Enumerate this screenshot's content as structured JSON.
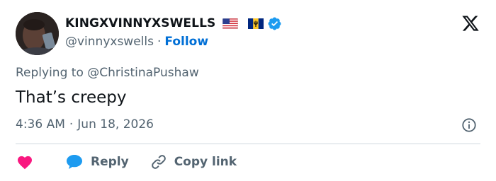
{
  "user": {
    "display_name": "KINGXVINNYXSWELLS",
    "handle": "@vinnyxswells",
    "separator": "·",
    "follow_label": "Follow",
    "flags": [
      "us-flag-icon",
      "barbados-flag-icon"
    ],
    "verified": true
  },
  "tweet": {
    "replying_prefix": "Replying to",
    "replying_to": "@ChristinaPushaw",
    "text": "That’s creepy",
    "time": "4:36 AM",
    "date_separator": "·",
    "date": "Jun 18, 2026"
  },
  "actions": {
    "reply_label": "Reply",
    "copy_link_label": "Copy link"
  },
  "colors": {
    "text_primary": "#0f1419",
    "text_secondary": "#536471",
    "link_blue": "#006fd6",
    "verified_blue": "#1d9bf0",
    "heart_red": "#f91880",
    "divider": "#cfd9de"
  },
  "icons": {
    "logo": "x-logo-icon",
    "info": "info-icon",
    "like": "heart-icon",
    "reply": "reply-bubble-icon",
    "copy": "link-icon"
  }
}
